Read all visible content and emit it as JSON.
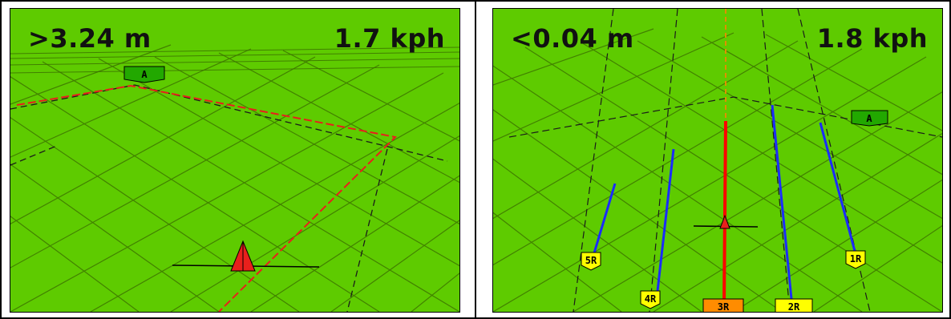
{
  "left_view": {
    "distance": ">3.24 m",
    "speed": "1.7 kph",
    "point_marker": "A",
    "vehicle_icon": "tractor-triangle-icon",
    "boundary_color": "#e8201c"
  },
  "right_view": {
    "distance": "<0.04 m",
    "speed": "1.8 kph",
    "point_marker": "A",
    "vehicle_icon": "tractor-triangle-icon",
    "guidance_color": "#ff0000",
    "row_color": "#1a2cff",
    "rows": [
      {
        "label": "5R"
      },
      {
        "label": "4R"
      },
      {
        "label": "3R",
        "active": true
      },
      {
        "label": "2R"
      },
      {
        "label": "1R"
      }
    ]
  },
  "colors": {
    "field": "#5ecb00",
    "grid": "#3a6e00",
    "label_bg": "#ffff00",
    "active_label_bg": "#ff8c00",
    "marker_bg": "#22a800"
  }
}
